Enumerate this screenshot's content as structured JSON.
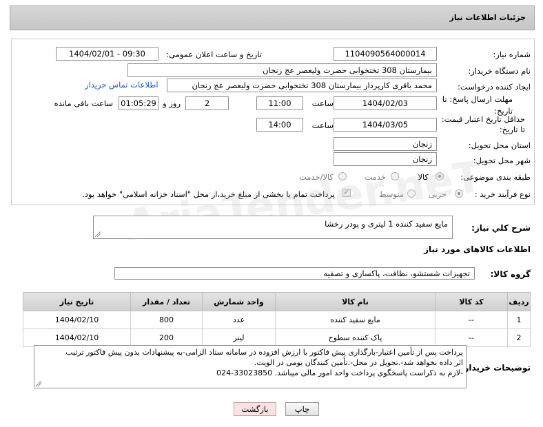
{
  "header": {
    "title": "جزئیات اطلاعات نیاز"
  },
  "form": {
    "need_number_label": "شماره نیاز:",
    "need_number": "1104090564000014",
    "announce_label": "تاریخ و ساعت اعلان عمومی:",
    "announce_value": "1404/02/01 - 09:30",
    "buyer_org_label": "نام دستگاه خریدار:",
    "buyer_org": "بیمارستان 308 تختخوابی حضرت ولیعصر عج  زنجان",
    "requester_label": "ایجاد کننده درخواست:",
    "requester": "محمد باقری کارپرداز بیمارستان 308 تختخوابی حضرت ولیعصر عج  زنجان",
    "contact_link": "اطلاعات تماس خریدار",
    "deadline_label": "مهلت ارسال پاسخ: تا تاریخ:",
    "deadline_date": "1404/02/03",
    "time_label": "ساعت",
    "deadline_time": "11:00",
    "days_value": "2",
    "days_label": "روز و",
    "remaining_time": "01:05:29",
    "remaining_label": "ساعت باقی مانده",
    "price_validity_label": "حداقل تاریخ اعتبار قیمت: تا تاریخ:",
    "price_validity_date": "1404/03/05",
    "price_validity_time": "14:00",
    "province_label": "استان محل تحویل:",
    "province": "زنجان",
    "city_label": "شهر محل تحویل:",
    "city": "زنجان",
    "category_label": "طبقه بندی موضوعی:",
    "category_options": [
      "کالا",
      "خدمت",
      "کالا/خدمت"
    ],
    "process_label": "نوع فرآیند خرید :",
    "process_options": [
      "جزیی",
      "متوسط"
    ],
    "payment_note": "پرداخت تمام یا بخشی از مبلغ خرید،از محل \"اسناد خزانه اسلامی\" خواهد بود."
  },
  "description": {
    "label": "شرح کلي نياز:",
    "text": "مایع سفید کننده 1 لیتری و پودر رخشا"
  },
  "goods_section": {
    "title": "اطلاعات کالاهای مورد نیاز",
    "group_label": "گروه کالا:",
    "group_value": "تجهیزات شستشو، نظافت، پاکسازی و تصفیه"
  },
  "table": {
    "headers": [
      "ردیف",
      "کد کالا",
      "نام کالا",
      "واحد شمارش",
      "تعداد / مقدار",
      "تاریخ نیاز"
    ],
    "rows": [
      [
        "1",
        "--",
        "مایع سفید کننده",
        "عدد",
        "800",
        "1404/02/10"
      ],
      [
        "2",
        "--",
        "پاک کننده سطوح",
        "لیتر",
        "200",
        "1404/02/10"
      ]
    ]
  },
  "buyer_notes": {
    "label": "توضیحات خریدار:",
    "lines": [
      "پرداخت پس از تأمین اعتبار-بارگذاری پیش فاکتور با ارزش افزوده در سامانه ستاد الزامی-به پیشنهادات بدون پیش فاکتور ترتیب",
      "اثر داده نخواهد شد-.تحویل در محل-.تأمین کنندگان بومی در الویت.",
      "-لازم به ذکراست پاسخگوی پرداخت واحد امور مالی میباشد. 33023850-024"
    ]
  },
  "buttons": {
    "print": "چاپ",
    "back": "بازگشت"
  },
  "colors": {
    "link": "#1a55c8",
    "header_bg": "#cfcfcf",
    "back_btn_bg": "#fbe3e3"
  }
}
